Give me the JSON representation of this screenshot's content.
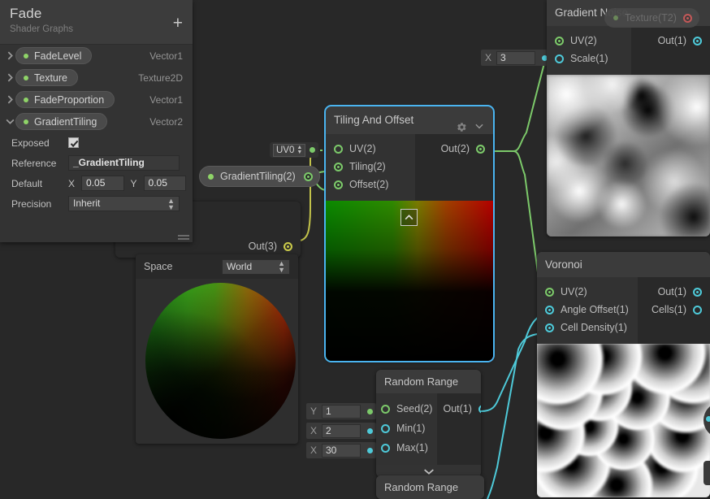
{
  "blackboard": {
    "title": "Fade",
    "subtitle": "Shader Graphs",
    "add_label": "+",
    "properties": [
      {
        "name": "FadeLevel",
        "type": "Vector1",
        "expanded": false
      },
      {
        "name": "Texture",
        "type": "Texture2D",
        "expanded": false
      },
      {
        "name": "FadeProportion",
        "type": "Vector1",
        "expanded": false
      },
      {
        "name": "GradientTiling",
        "type": "Vector2",
        "expanded": true
      }
    ],
    "details": {
      "exposed_label": "Exposed",
      "exposed_checked": true,
      "reference_label": "Reference",
      "reference_value": "_GradientTiling",
      "default_label": "Default",
      "default_x_axis": "X",
      "default_x_value": "0.05",
      "default_y_axis": "Y",
      "default_y_value": "0.05",
      "precision_label": "Precision",
      "precision_value": "Inherit"
    }
  },
  "graph": {
    "uv0_chip": {
      "label": "UV0"
    },
    "gradient_tiling_node": {
      "label": "GradientTiling(2)"
    },
    "texture_ghost": {
      "label": "Texture(T2)"
    },
    "scale_field": {
      "axis": "X",
      "value": "3"
    },
    "seed_field": {
      "axis": "Y",
      "value": "1"
    },
    "min_field": {
      "axis": "X",
      "value": "2"
    },
    "max_field": {
      "axis": "X",
      "value": "30"
    },
    "partial_node_out": {
      "label": "Out(3)"
    },
    "space_node": {
      "label": "Space",
      "value": "World"
    }
  },
  "nodes": {
    "tiling_and_offset": {
      "title": "Tiling And Offset",
      "selected": true,
      "inputs": [
        {
          "label": "UV(2)",
          "type": "vector",
          "connected": false
        },
        {
          "label": "Tiling(2)",
          "type": "vector",
          "connected": true
        },
        {
          "label": "Offset(2)",
          "type": "vector",
          "connected": true
        }
      ],
      "outputs": [
        {
          "label": "Out(2)",
          "type": "vector",
          "connected": true
        }
      ],
      "has_preview": true,
      "has_gear": true,
      "has_chevron": true
    },
    "gradient_noise": {
      "title": "Gradient Noise",
      "selected": false,
      "inputs": [
        {
          "label": "UV(2)",
          "type": "vector",
          "connected": true
        },
        {
          "label": "Scale(1)",
          "type": "float",
          "connected": false
        }
      ],
      "outputs": [
        {
          "label": "Out(1)",
          "type": "float",
          "connected": true
        }
      ],
      "has_preview": true
    },
    "voronoi": {
      "title": "Voronoi",
      "selected": false,
      "inputs": [
        {
          "label": "UV(2)",
          "type": "vector",
          "connected": true
        },
        {
          "label": "Angle Offset(1)",
          "type": "float",
          "connected": true
        },
        {
          "label": "Cell Density(1)",
          "type": "float",
          "connected": true
        }
      ],
      "outputs": [
        {
          "label": "Out(1)",
          "type": "float",
          "connected": true
        },
        {
          "label": "Cells(1)",
          "type": "float",
          "connected": false
        }
      ],
      "has_preview": true
    },
    "random_range_1": {
      "title": "Random Range",
      "selected": false,
      "inputs": [
        {
          "label": "Seed(2)",
          "type": "vector",
          "connected": true
        },
        {
          "label": "Min(1)",
          "type": "float",
          "connected": true
        },
        {
          "label": "Max(1)",
          "type": "float",
          "connected": true
        }
      ],
      "outputs": [
        {
          "label": "Out(1)",
          "type": "float",
          "connected": true
        }
      ],
      "collapsed_preview": true
    },
    "random_range_2": {
      "title": "Random Range",
      "selected": false
    }
  },
  "colors": {
    "vector_wire": "#7cc96a",
    "float_wire": "#4ec9d8",
    "texture_wire": "#9a6a6a",
    "vector3_wire": "#c9c94a",
    "selection": "#4ab4f0",
    "panel_bg": "#333333",
    "node_bg": "#292929",
    "node_title_bg": "#3b3b3b",
    "canvas_bg": "#282828"
  }
}
